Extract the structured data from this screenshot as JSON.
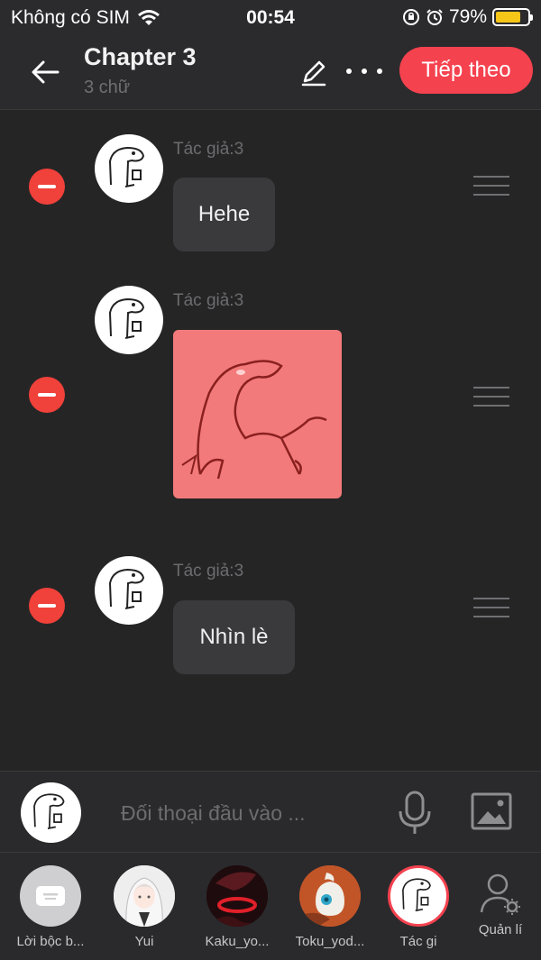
{
  "status_bar": {
    "carrier": "Không có SIM",
    "time": "00:54",
    "battery_percent": "79%",
    "battery_level": 0.79,
    "battery_color": "#f5c518"
  },
  "header": {
    "title": "Chapter 3",
    "subtitle": "3 chữ",
    "next_label": "Tiếp theo",
    "accent_color": "#f5424f"
  },
  "messages": [
    {
      "author": "Tác giả:3",
      "type": "text",
      "text": "Hehe"
    },
    {
      "author": "Tác giả:3",
      "type": "image",
      "image_bg": "#f37a7a"
    },
    {
      "author": "Tác giả:3",
      "type": "text",
      "text": "Nhìn lè"
    }
  ],
  "input": {
    "placeholder": "Đối thoại đầu vào ..."
  },
  "characters": [
    {
      "name": "Lời bộc b...",
      "icon": "narration-icon"
    },
    {
      "name": "Yui",
      "icon": "avatar"
    },
    {
      "name": "Kaku_yo...",
      "icon": "avatar"
    },
    {
      "name": "Toku_yod...",
      "icon": "avatar"
    },
    {
      "name": "Tác gi",
      "icon": "avatar",
      "selected": true
    }
  ],
  "manage_label": "Quản lí",
  "icons": {
    "back": "arrow-left-icon",
    "edit": "pencil-icon",
    "more": "more-icon",
    "mic": "microphone-icon",
    "image": "image-icon",
    "manage": "user-settings-icon"
  }
}
